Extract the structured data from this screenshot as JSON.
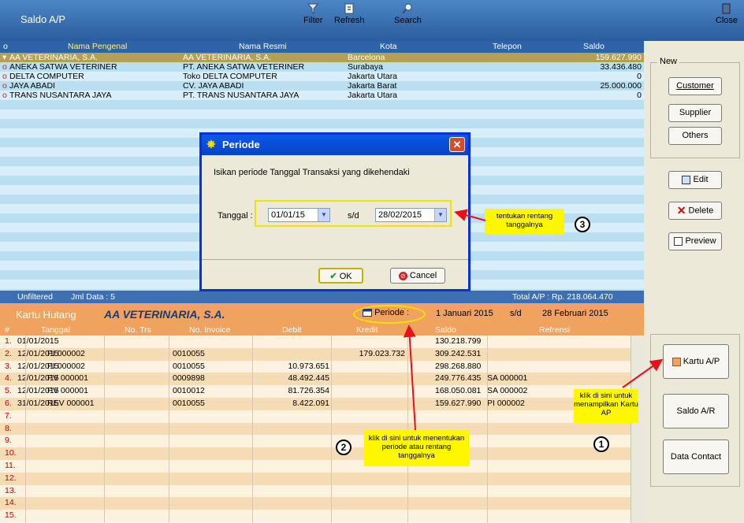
{
  "app": {
    "title": "Saldo A/P"
  },
  "toolbar": {
    "filter": "Filter",
    "refresh": "Refresh",
    "search": "Search",
    "close": "Close"
  },
  "top_grid": {
    "headers": [
      "o",
      "Nama Pengenal",
      "Nama Resmi",
      "Kota",
      "Telepon",
      "Saldo"
    ],
    "rows": [
      {
        "mark": "▾",
        "nama": "AA VETERINARIA, S.A.",
        "resmi": "AA VETERINARIA, S.A.",
        "kota": "Barcelona",
        "telepon": "",
        "saldo": "159.627.990"
      },
      {
        "mark": "o",
        "nama": "ANEKA SATWA VETERINER",
        "resmi": "PT. ANEKA SATWA VETERINER",
        "kota": "Surabaya",
        "telepon": "",
        "saldo": "33.436.480"
      },
      {
        "mark": "o",
        "nama": "DELTA COMPUTER",
        "resmi": "Toko DELTA COMPUTER",
        "kota": "Jakarta Utara",
        "telepon": "",
        "saldo": "0"
      },
      {
        "mark": "o",
        "nama": "JAYA ABADI",
        "resmi": "CV. JAYA ABADI",
        "kota": "Jakarta Barat",
        "telepon": "",
        "saldo": "25.000.000"
      },
      {
        "mark": "o",
        "nama": "TRANS NUSANTARA JAYA",
        "resmi": "PT. TRANS NUSANTARA JAYA",
        "kota": "Jakarta Utara",
        "telepon": "",
        "saldo": "0"
      }
    ]
  },
  "status": {
    "filter": "Unfiltered",
    "count": "Jml Data : 5",
    "total": "Total A/P : Rp. 218.064.470"
  },
  "kartu": {
    "title": "Kartu Hutang",
    "name": "AA VETERINARIA, S.A.",
    "periode_label": "Periode :",
    "start": "1 Januari 2015",
    "sd": "s/d",
    "end": "28 Februari 2015"
  },
  "bottom_grid": {
    "headers": [
      "#",
      "Tanggal",
      "No. Trs",
      "No. Invoice",
      "Debit",
      "Kredit",
      "Saldo",
      "Refrensi"
    ],
    "rows": [
      {
        "n": "1.",
        "tgl": "01/01/2015",
        "trs": "",
        "inv": "",
        "debit": "",
        "kredit": "",
        "saldo": "130.218.799",
        "ref": ""
      },
      {
        "n": "2.",
        "tgl": "12/01/2015",
        "trs": "PI 000002",
        "inv": "0010055",
        "debit": "",
        "kredit": "179.023.732",
        "saldo": "309.242.531",
        "ref": ""
      },
      {
        "n": "3.",
        "tgl": "12/01/2015",
        "trs": "PI 000002",
        "inv": "0010055",
        "debit": "10.973.651",
        "kredit": "",
        "saldo": "298.268.880",
        "ref": ""
      },
      {
        "n": "4.",
        "tgl": "12/01/2015",
        "trs": "PV 000001",
        "inv": "0009898",
        "debit": "48.492.445",
        "kredit": "",
        "saldo": "249.776.435",
        "ref": "SA 000001"
      },
      {
        "n": "5.",
        "tgl": "12/01/2015",
        "trs": "PV 000001",
        "inv": "0010012",
        "debit": "81.726.354",
        "kredit": "",
        "saldo": "168.050.081",
        "ref": "SA 000002"
      },
      {
        "n": "6.",
        "tgl": "31/01/2015",
        "trs": "REV 000001",
        "inv": "0010055",
        "debit": "8.422.091",
        "kredit": "",
        "saldo": "159.627.990",
        "ref": "PI 000002"
      },
      {
        "n": "7."
      },
      {
        "n": "8."
      },
      {
        "n": "9."
      },
      {
        "n": "10."
      },
      {
        "n": "11."
      },
      {
        "n": "12."
      },
      {
        "n": "13."
      },
      {
        "n": "14."
      },
      {
        "n": "15."
      }
    ]
  },
  "right_panel": {
    "new_group": "New",
    "customer": "Customer",
    "supplier": "Supplier",
    "others": "Others",
    "edit": "Edit",
    "delete": "Delete",
    "preview": "Preview",
    "kartu_ap": "Kartu A/P",
    "saldo_ar": "Saldo A/R",
    "data_contact": "Data Contact"
  },
  "dialog": {
    "title": "Periode",
    "message": "Isikan periode Tanggal Transaksi yang dikehendaki",
    "tanggal_label": "Tanggal :",
    "start_value": "01/01/15",
    "sd": "s/d",
    "end_value": "28/02/2015",
    "ok": "OK",
    "cancel": "Cancel"
  },
  "annotations": {
    "callout1": "klik di sini untuk menampilkan Kartu AP",
    "callout2": "klik di sini untuk menentukan periode atau rentang tanggalnya",
    "callout3": "tentukan rentang tanggalnya",
    "num1": "1",
    "num2": "2",
    "num3": "3"
  },
  "colors": {
    "accent_orange": "#f0a35e",
    "grid_blue": "#b9dff0",
    "header_blue": "#2f63a9",
    "callout_yellow": "#fff700",
    "arrow_red": "#e8101a"
  }
}
